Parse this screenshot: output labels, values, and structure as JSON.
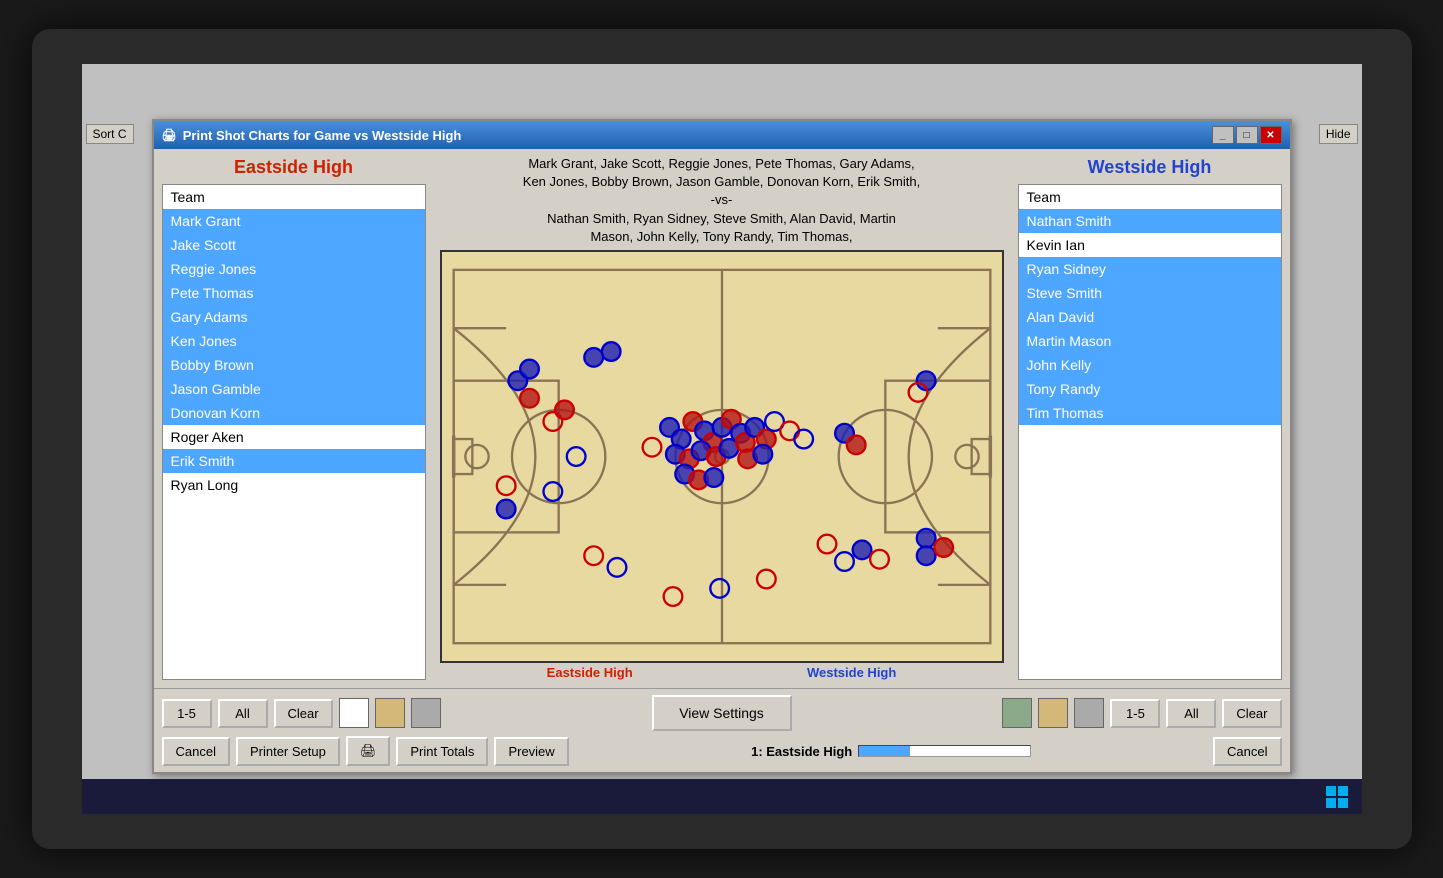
{
  "window": {
    "title": "Print Shot Charts for Game vs Westside High",
    "sort_button": "Sort C",
    "hide_button": "Hide"
  },
  "eastside": {
    "team_name": "Eastside High",
    "players_label": "Team",
    "players": [
      {
        "name": "Mark Grant",
        "selected": true
      },
      {
        "name": "Jake Scott",
        "selected": true
      },
      {
        "name": "Reggie Jones",
        "selected": true
      },
      {
        "name": "Pete Thomas",
        "selected": true
      },
      {
        "name": "Gary Adams",
        "selected": true
      },
      {
        "name": "Ken Jones",
        "selected": true
      },
      {
        "name": "Bobby Brown",
        "selected": true
      },
      {
        "name": "Jason Gamble",
        "selected": true
      },
      {
        "name": "Donovan Korn",
        "selected": true
      },
      {
        "name": "Roger Aken",
        "selected": false
      },
      {
        "name": "Erik Smith",
        "selected": true
      },
      {
        "name": "Ryan Long",
        "selected": false
      }
    ]
  },
  "westside": {
    "team_name": "Westside High",
    "players_label": "Team",
    "players": [
      {
        "name": "Nathan Smith",
        "selected": true
      },
      {
        "name": "Kevin Ian",
        "selected": false
      },
      {
        "name": "Ryan Sidney",
        "selected": true
      },
      {
        "name": "Steve Smith",
        "selected": true
      },
      {
        "name": "Alan David",
        "selected": true
      },
      {
        "name": "Martin Mason",
        "selected": true
      },
      {
        "name": "John Kelly",
        "selected": true
      },
      {
        "name": "Tony Randy",
        "selected": true
      },
      {
        "name": "Tim Thomas",
        "selected": true
      }
    ]
  },
  "court": {
    "players_text_line1": "Mark Grant, Jake Scott, Reggie Jones, Pete Thomas, Gary Adams,",
    "players_text_line2": "Ken Jones, Bobby Brown, Jason Gamble, Donovan Korn, Erik Smith,",
    "vs_text": "-vs-",
    "players_text_line3": "Nathan Smith, Ryan Sidney, Steve Smith, Alan David, Martin",
    "players_text_line4": "Mason, John Kelly, Tony Randy, Tim Thomas,",
    "label_eastside": "Eastside High",
    "label_westside": "Westside High"
  },
  "toolbar": {
    "btn_1_5_left": "1-5",
    "btn_all_left": "All",
    "btn_clear_left": "Clear",
    "btn_view_settings": "View Settings",
    "btn_1_5_right": "1-5",
    "btn_all_right": "All",
    "btn_clear_right": "Clear",
    "btn_cancel_left": "Cancel",
    "btn_printer_setup": "Printer Setup",
    "btn_print_totals": "Print Totals",
    "btn_preview": "Preview",
    "status_text": "1: Eastside High",
    "btn_cancel_right": "Cancel"
  },
  "swatches": {
    "left": [
      "#ffffff",
      "#d4b87a",
      "#aaaaaa"
    ],
    "right": [
      "#8aaa8a",
      "#d4b87a",
      "#aaaaaa"
    ]
  }
}
